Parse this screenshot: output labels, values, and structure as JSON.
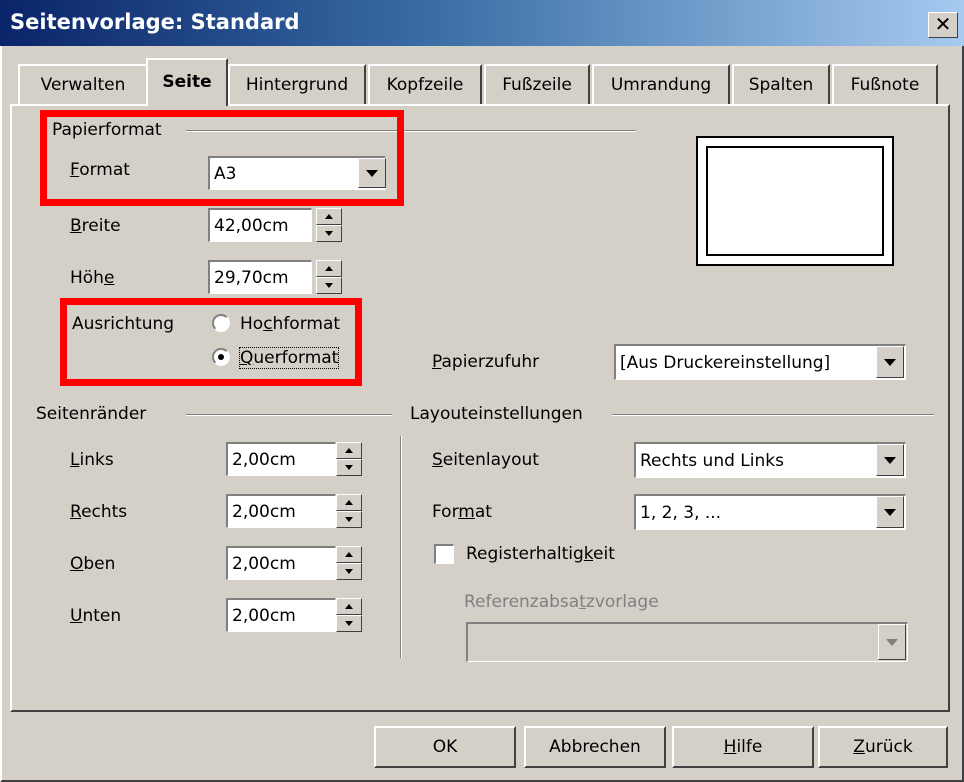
{
  "window": {
    "title": "Seitenvorlage: Standard",
    "close_glyph": "✕"
  },
  "tabs": [
    {
      "label": "Verwalten"
    },
    {
      "label": "Seite",
      "active": true
    },
    {
      "label": "Hintergrund"
    },
    {
      "label": "Kopfzeile"
    },
    {
      "label": "Fußzeile"
    },
    {
      "label": "Umrandung"
    },
    {
      "label": "Spalten"
    },
    {
      "label": "Fußnote"
    }
  ],
  "paper": {
    "group_label": "Papierformat",
    "format_label": "Format",
    "format_value": "A3",
    "width_label": "Breite",
    "width_value": "42,00cm",
    "height_label": "Höhe",
    "height_value": "29,70cm",
    "orientation_label": "Ausrichtung",
    "portrait_label": "Hochformat",
    "landscape_label": "Querformat",
    "selected_orientation": "Querformat"
  },
  "paper_tray": {
    "label": "Papierzufuhr",
    "value": "[Aus Druckereinstellung]"
  },
  "margins": {
    "group_label": "Seitenränder",
    "left_label": "Links",
    "left_value": "2,00cm",
    "right_label": "Rechts",
    "right_value": "2,00cm",
    "top_label": "Oben",
    "top_value": "2,00cm",
    "bottom_label": "Unten",
    "bottom_value": "2,00cm"
  },
  "layout": {
    "group_label": "Layouteinstellungen",
    "page_layout_label": "Seitenlayout",
    "page_layout_value": "Rechts und Links",
    "format_label": "Format",
    "format_value": "1, 2, 3, ...",
    "register_true_label": "Registerhaltigkeit",
    "register_true_checked": false,
    "reference_style_label": "Referenzabsatzvorlage",
    "reference_style_value": ""
  },
  "buttons": {
    "ok": "OK",
    "cancel": "Abbrechen",
    "help": "Hilfe",
    "back": "Zurück"
  },
  "colors": {
    "highlight": "#ff0000",
    "titlebar": "#0a246a",
    "dialog_bg": "#d4d0c8"
  }
}
